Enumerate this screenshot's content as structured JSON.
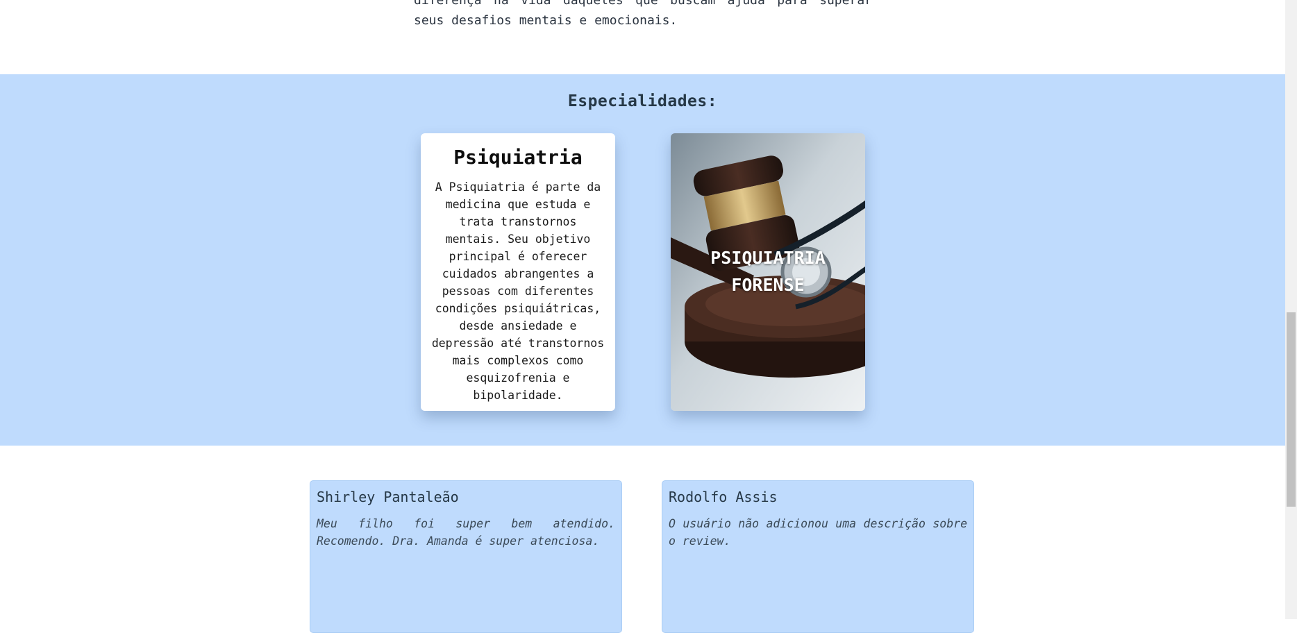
{
  "intro": {
    "text": "diferença na vida daqueles que buscam ajuda para superar seus desafios mentais e emocionais."
  },
  "specialties": {
    "title": "Especialidades:",
    "cards": [
      {
        "title": "Psiquiatria",
        "description": "A Psiquiatria é parte da medicina que estuda e trata transtornos mentais. Seu objetivo principal é oferecer cuidados abrangentes a pessoas com diferentes condições psiquiátricas, desde ansiedade e depressão até transtornos mais complexos como esquizofrenia e bipolaridade."
      },
      {
        "title": "PSIQUIATRIA FORENSE",
        "image": "gavel-and-stethoscope"
      }
    ]
  },
  "reviews": [
    {
      "author": "Shirley Pantaleão",
      "text": "Meu filho foi super bem atendido. Recomendo. Dra. Amanda é super atenciosa."
    },
    {
      "author": "Rodolfo Assis",
      "text": "O usuário não adicionou uma descrição sobre o review."
    }
  ],
  "colors": {
    "section_bg": "#bfdbfd",
    "card_bg": "#ffffff"
  }
}
